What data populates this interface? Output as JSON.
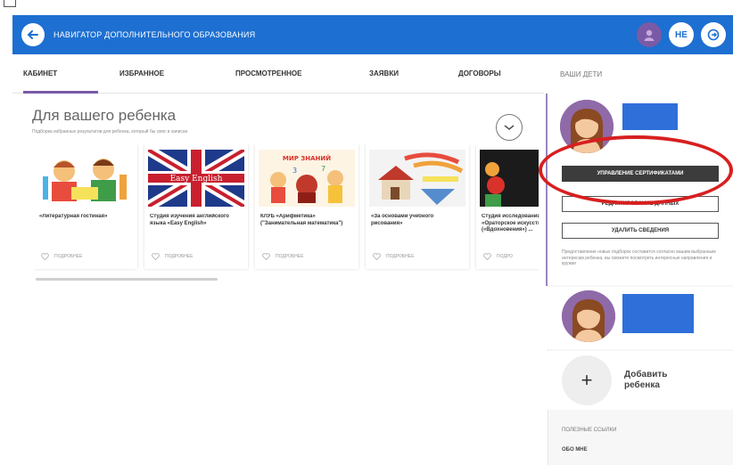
{
  "header": {
    "title": "НАВИГАТОР ДОПОЛНИТЕЛЬНОГО ОБРАЗОВАНИЯ",
    "right_button_2": "НЕ"
  },
  "tabs": [
    {
      "label": "КАБИНЕТ",
      "active": true
    },
    {
      "label": "ИЗБРАННОЕ",
      "active": false
    },
    {
      "label": "ПРОСМОТРЕННОЕ",
      "active": false
    },
    {
      "label": "ЗАЯВКИ",
      "active": false
    },
    {
      "label": "ДОГОВОРЫ",
      "active": false
    }
  ],
  "children_tab": "ВАШИ ДЕТИ",
  "main": {
    "title": "Для вашего ребенка",
    "subtitle": "Подборка избранных результатов для ребенка, который бы смог и записан"
  },
  "cards": [
    {
      "title": "«Литературная гостиная»",
      "footer": "ПОДРОБНЕЕ"
    },
    {
      "title": "Студия изучения английского языка «Easy English»",
      "footer": "ПОДРОБНЕЕ"
    },
    {
      "title": "КЛУБ «Арифметика» (\"Занимательная математика\")",
      "footer": "ПОДРОБНЕЕ"
    },
    {
      "title": "«За основами учебного рисования»",
      "footer": "ПОДРОБНЕЕ"
    },
    {
      "title": "Студия исследований «Ораторское искусство» («Вдохновения») ...",
      "footer": "ПОДРО"
    }
  ],
  "card2_image_text": "Easy English",
  "card3_image_text": "МИР ЗНАНИЙ",
  "sidebar": {
    "buttons": {
      "manage_certificates": "УПРАВЛЕНИЕ СЕРТИФИКАТАМИ",
      "edit_data": "РЕДАКТИРОВАНИЕ ДАННЫХ",
      "delete_data": "УДАЛИТЬ СВЕДЕНИЯ"
    },
    "note": "Предоставление новых подборок составится согласно вашим выбранным интересам ребенка, вы сможете посмотреть интересные направления и кружки",
    "add_child": "Добавить ребенка",
    "add_symbol": "+",
    "links_title": "ПОЛЕЗНЫЕ ССЫЛКИ",
    "links_item": "ОБО МНЕ"
  },
  "colors": {
    "brand": "#1d6fd1",
    "accent": "#7a5aa6",
    "highlight": "#d81f1f"
  }
}
